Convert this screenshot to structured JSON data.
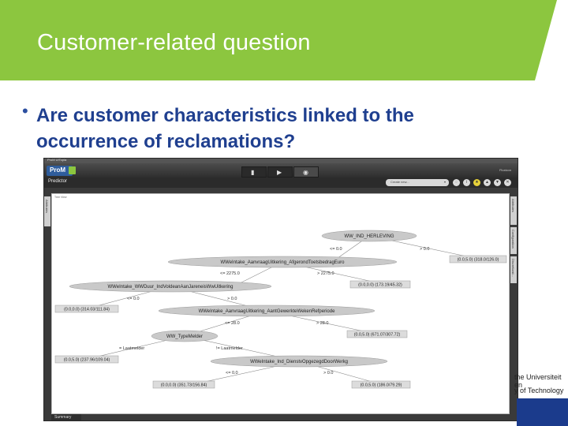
{
  "slide": {
    "title": "Customer-related question",
    "bullet": "Are customer characteristics linked to the occurrence of reclamations?",
    "colors": {
      "header": "#8cc63f",
      "title_text": "#ffffff",
      "bullet_text": "#1f3f8f",
      "brand_bar": "#1b3b8c"
    },
    "branding": [
      "the Universiteit",
      "en",
      "y of Technology"
    ]
  },
  "prom": {
    "window_title": "ProM UITopia",
    "logo": "ProM",
    "tabs": [
      {
        "name": "workspace",
        "icon": "folder-icon",
        "glyph": "▮"
      },
      {
        "name": "actions",
        "icon": "play-icon",
        "glyph": "▶"
      },
      {
        "name": "views",
        "icon": "eye-icon",
        "glyph": "◉"
      }
    ],
    "brand": "Fluxicon",
    "view_label": "Predictor",
    "dropdown": {
      "value": "Create new...",
      "arrow": "▾"
    },
    "toolbar_buttons": [
      {
        "name": "refresh",
        "icon": "refresh-icon",
        "glyph": "◌"
      },
      {
        "name": "info",
        "icon": "info-icon",
        "glyph": "i"
      },
      {
        "name": "favorite",
        "icon": "star-icon",
        "glyph": "★"
      },
      {
        "name": "import",
        "icon": "import-icon",
        "glyph": "▲"
      },
      {
        "name": "export",
        "icon": "export-icon",
        "glyph": "▼"
      },
      {
        "name": "close",
        "icon": "close-icon",
        "glyph": "✕"
      }
    ],
    "left_tab": "Attributes",
    "right_tabs": [
      "Attributes",
      "Configuration",
      "Discretizati..."
    ],
    "tree_view_label": "Tree View",
    "summary_tab": "Summary",
    "tree": {
      "nodes": [
        {
          "id": "n1",
          "label": "WW_IND_HERLEVING"
        },
        {
          "id": "n2",
          "label": "WWeIntake_AanvraagUitkering_AfgerondToetsbedragEuro"
        },
        {
          "id": "n3",
          "label": "WWeIntake_WWDuur_IndVoldeanAanJareneisWwUitkering"
        },
        {
          "id": "n4",
          "label": "WWeIntake_AanvraagUitkering_AantGewerkteWekenRefperiode"
        },
        {
          "id": "n5",
          "label": "WW_TypeMelder"
        },
        {
          "id": "n6",
          "label": "WWeIntake_Ind_DienstvOpgezegdDoorWerkg"
        }
      ],
      "leaves": [
        {
          "id": "l1",
          "label": "(0.0,5.0) (318.0/126.0)"
        },
        {
          "id": "l2",
          "label": "(0.0,0.0) (173.19/45.32)"
        },
        {
          "id": "l3",
          "label": "(0.0,0.0) (314.03/111.84)"
        },
        {
          "id": "l4",
          "label": "(0.0,5.0) (671.07/307.72)"
        },
        {
          "id": "l5",
          "label": "(0.0,5.0) (237.96/109.04)"
        },
        {
          "id": "l6",
          "label": "(0.0,0.0) (351.73/156.84)"
        },
        {
          "id": "l7",
          "label": "(0.0,5.0) (186.0/79.29)"
        }
      ],
      "edges": [
        {
          "id": "e1",
          "label": "<= 0.0"
        },
        {
          "id": "e2",
          "label": "> 0.0"
        },
        {
          "id": "e3",
          "label": "<= 2275.0"
        },
        {
          "id": "e4",
          "label": "> 2275.0"
        },
        {
          "id": "e5",
          "label": "<= 0.0"
        },
        {
          "id": "e6",
          "label": "> 0.0"
        },
        {
          "id": "e7",
          "label": "<= 28.0"
        },
        {
          "id": "e8",
          "label": "> 28.0"
        },
        {
          "id": "e9",
          "label": "= Laatmelder"
        },
        {
          "id": "e10",
          "label": "!= Laatmelder"
        },
        {
          "id": "e11",
          "label": "<= 0.0"
        },
        {
          "id": "e12",
          "label": "> 0.0"
        }
      ]
    }
  }
}
